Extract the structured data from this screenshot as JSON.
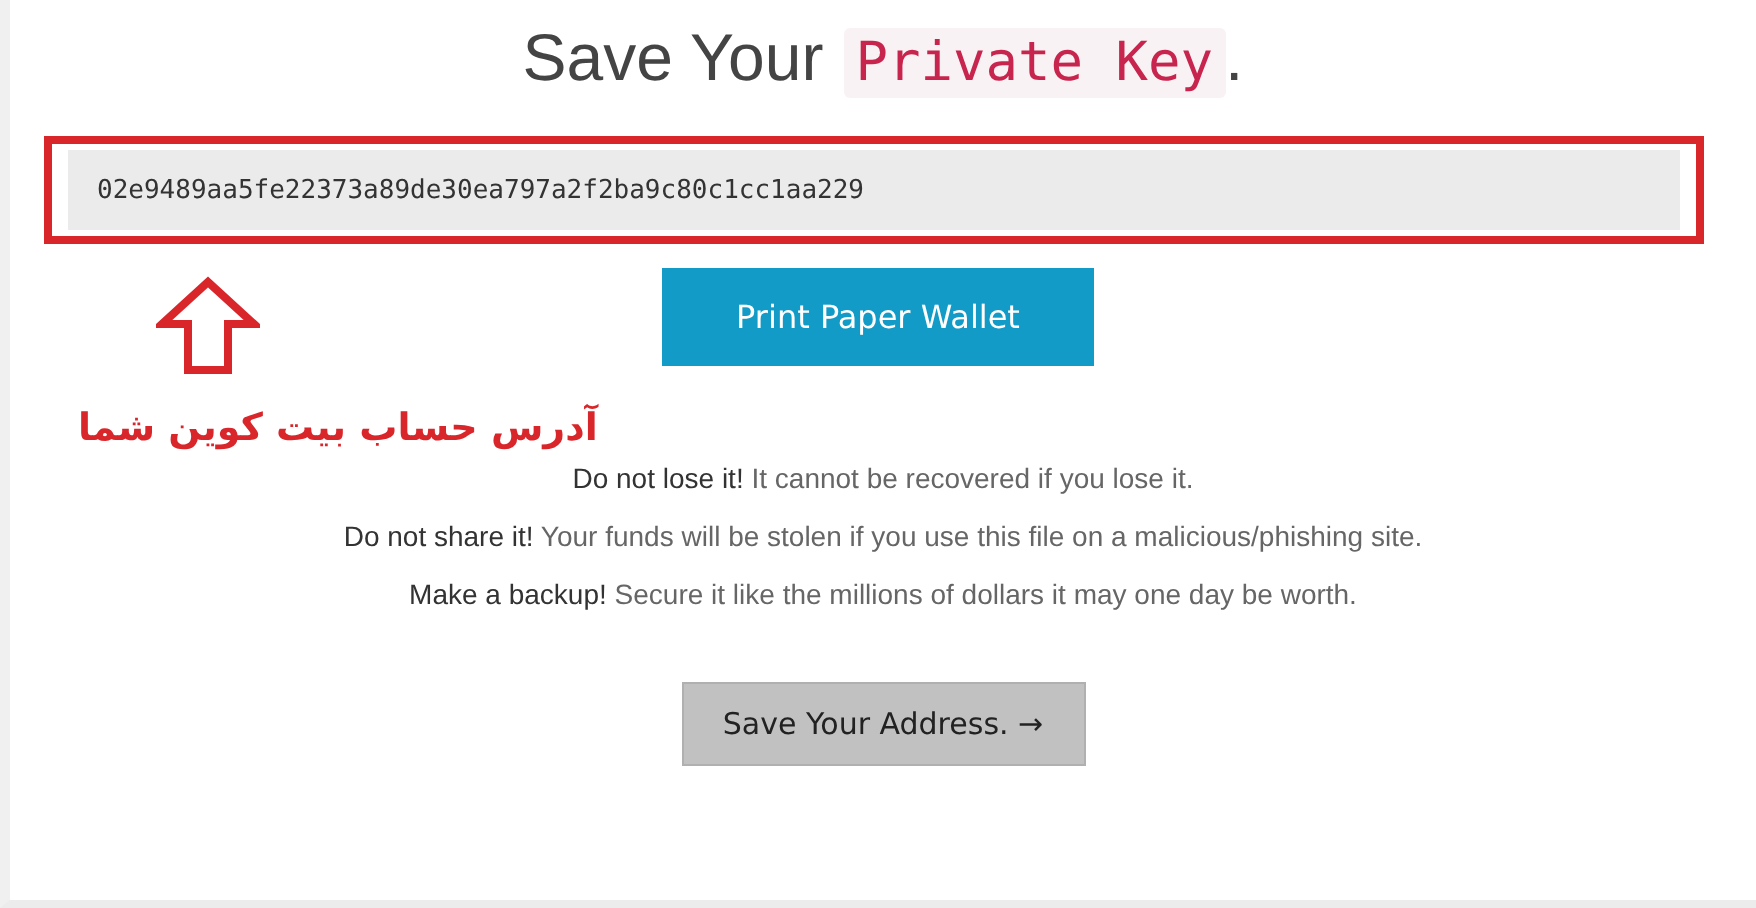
{
  "title": {
    "prefix": "Save Your",
    "code": "Private Key",
    "suffix": "."
  },
  "private_key": {
    "value": "02e9489aa5fe22373a89de30ea797a2f2ba9c80c1cc1aa229"
  },
  "print_button": {
    "label": "Print Paper Wallet"
  },
  "annotation": {
    "text": "آدرس حساب بیت کوین شما"
  },
  "notes": [
    "**Do not lose it!** It cannot be recovered if you lose it.",
    "**Do not share it!** Your funds will be stolen if you use this file on a malicious/phishing site.",
    "**Make a backup!** Secure it like the millions of dollars it may one day be worth."
  ],
  "next_button": {
    "label": "Save Your Address. →"
  }
}
